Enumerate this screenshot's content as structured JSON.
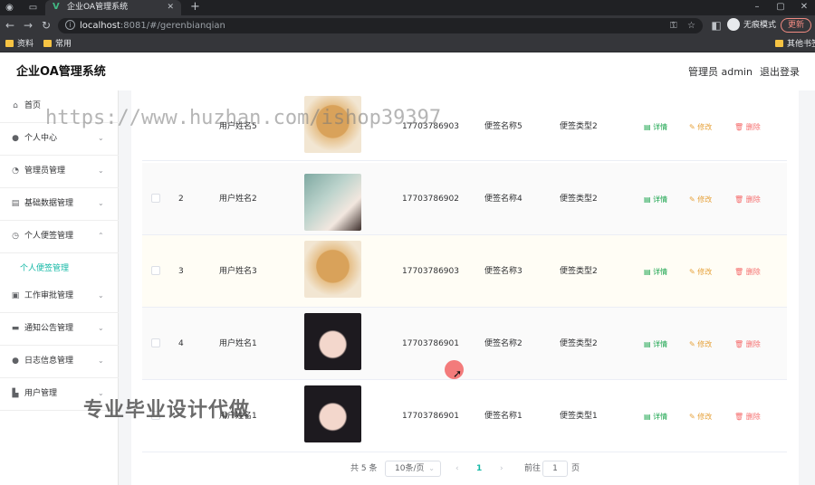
{
  "browser": {
    "tab_title": "企业OA管理系统",
    "new_tab": "+",
    "url_host": "localhost",
    "url_path": ":8081/#/gerenbianqian",
    "incognito_label": "无痕模式",
    "update_label": "更新",
    "bookmarks": [
      "资料",
      "常用"
    ],
    "other_bookmarks": "其他书签",
    "window_controls": [
      "–",
      "▢",
      "✕"
    ]
  },
  "app": {
    "title": "企业OA管理系统",
    "admin_label": "管理员 admin",
    "logout": "退出登录"
  },
  "sidebar": {
    "items": [
      {
        "label": "首页",
        "icon": "home-icon"
      },
      {
        "label": "个人中心",
        "icon": "user-icon"
      },
      {
        "label": "管理员管理",
        "icon": "admin-icon"
      },
      {
        "label": "基础数据管理",
        "icon": "database-icon"
      },
      {
        "label": "个人便签管理",
        "icon": "clock-icon"
      },
      {
        "label": "工作审批管理",
        "icon": "clipboard-icon"
      },
      {
        "label": "通知公告管理",
        "icon": "notice-icon"
      },
      {
        "label": "日志信息管理",
        "icon": "log-icon"
      },
      {
        "label": "用户管理",
        "icon": "users-icon"
      }
    ],
    "sub_active": "个人便签管理"
  },
  "table": {
    "rows": [
      {
        "index": "",
        "user": "用户姓名5",
        "phone": "17703786903",
        "note": "便签名称5",
        "type": "便签类型2",
        "photo": "dog"
      },
      {
        "index": "2",
        "user": "用户姓名2",
        "phone": "17703786902",
        "note": "便签名称4",
        "type": "便签类型2",
        "photo": "girl-a"
      },
      {
        "index": "3",
        "user": "用户姓名3",
        "phone": "17703786903",
        "note": "便签名称3",
        "type": "便签类型2",
        "photo": "dog"
      },
      {
        "index": "4",
        "user": "用户姓名1",
        "phone": "17703786901",
        "note": "便签名称2",
        "type": "便签类型2",
        "photo": "girl-b"
      },
      {
        "index": "",
        "user": "用户姓名1",
        "phone": "17703786901",
        "note": "便签名称1",
        "type": "便签类型1",
        "photo": "girl-b"
      }
    ],
    "actions": {
      "detail": "详情",
      "edit": "修改",
      "delete": "删除"
    }
  },
  "pagination": {
    "total": "共 5 条",
    "page_size": "10条/页",
    "prev": "‹",
    "current": "1",
    "next": "›",
    "goto_label": "前往",
    "goto_value": "1",
    "page_unit": "页"
  },
  "overlays": {
    "watermark": "https://www.huzhan.com/ishop39397",
    "promo": "专业毕业设计代做"
  }
}
